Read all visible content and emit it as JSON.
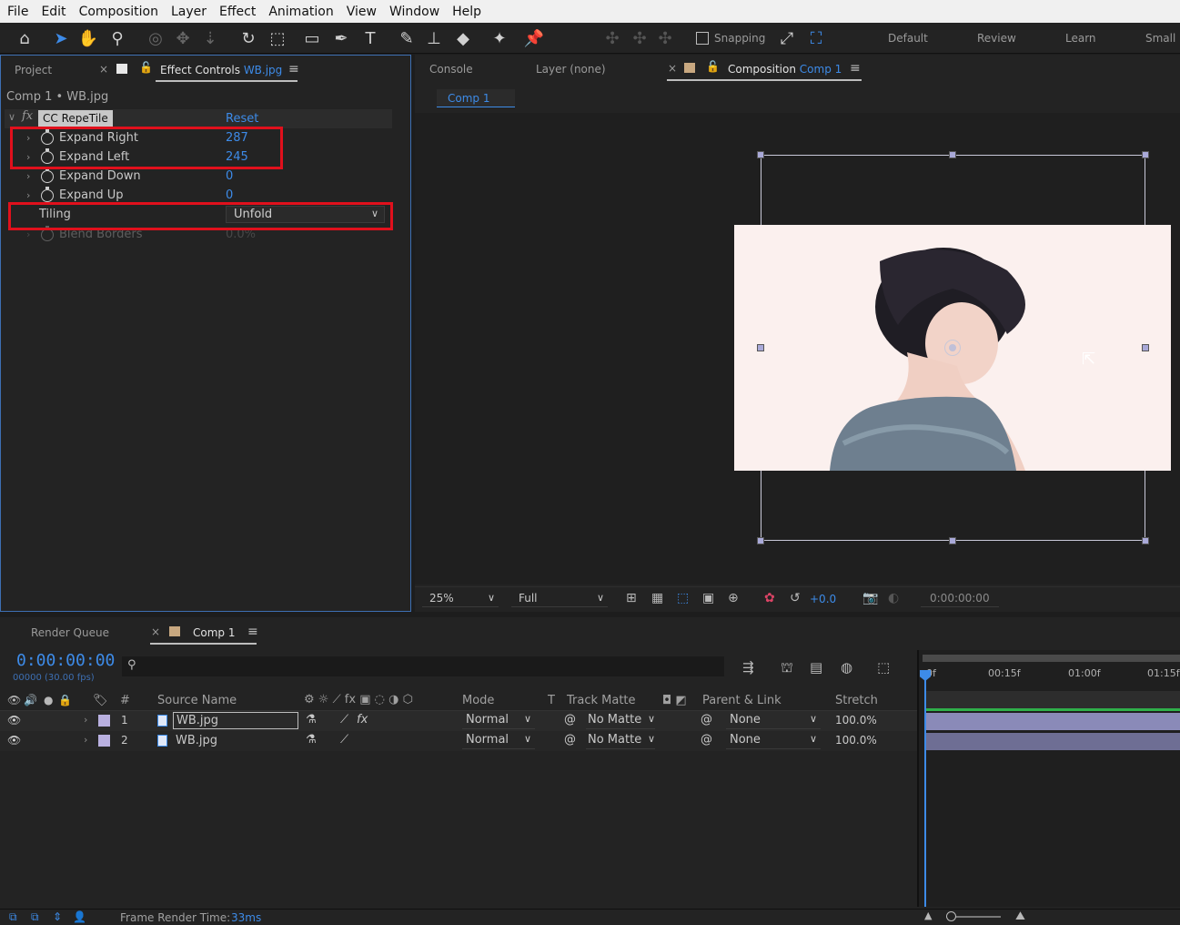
{
  "menu": [
    "File",
    "Edit",
    "Composition",
    "Layer",
    "Effect",
    "Animation",
    "View",
    "Window",
    "Help"
  ],
  "toolbar": {
    "snapping_label": "Snapping",
    "workspaces": [
      "Default",
      "Review",
      "Learn",
      "Small"
    ]
  },
  "left_panel": {
    "tab_project": "Project",
    "tab_effect_controls": "Effect Controls",
    "tab_effect_controls_target": "WB.jpg",
    "breadcrumb": "Comp 1 • WB.jpg",
    "effect_fx": "fx",
    "effect_name": "CC RepeTile",
    "reset_label": "Reset",
    "params": [
      {
        "name": "Expand Right",
        "value": "287"
      },
      {
        "name": "Expand Left",
        "value": "245"
      },
      {
        "name": "Expand Down",
        "value": "0"
      },
      {
        "name": "Expand Up",
        "value": "0"
      }
    ],
    "tiling_label": "Tiling",
    "tiling_value": "Unfold",
    "blend_label": "Blend Borders",
    "blend_value": "0.0%"
  },
  "viewer": {
    "tab_console": "Console",
    "tab_layer": "Layer (none)",
    "tab_composition": "Composition",
    "tab_composition_target": "Comp 1",
    "comp_subtab": "Comp 1",
    "zoom": "25%",
    "resolution": "Full",
    "exposure": "+0.0",
    "timecode": "0:00:00:00"
  },
  "timeline": {
    "tab_render_queue": "Render Queue",
    "tab_comp": "Comp 1",
    "current_time": "0:00:00:00",
    "frame_info": "00000 (30.00 fps)",
    "search_placeholder": "",
    "ruler": [
      "0f",
      "00:15f",
      "01:00f",
      "01:15f"
    ],
    "headers": {
      "num": "#",
      "source": "Source Name",
      "mode": "Mode",
      "t": "T",
      "track_matte": "Track Matte",
      "parent": "Parent & Link",
      "stretch": "Stretch"
    },
    "layers": [
      {
        "num": "1",
        "name": "WB.jpg",
        "mode": "Normal",
        "matte": "No Matte",
        "parent": "None",
        "stretch": "100.0%"
      },
      {
        "num": "2",
        "name": "WB.jpg",
        "mode": "Normal",
        "matte": "No Matte",
        "parent": "None",
        "stretch": "100.0%"
      }
    ],
    "frame_render_label": "Frame Render Time:",
    "frame_render_value": "33ms"
  },
  "colors": {
    "accent": "#3d8be8",
    "highlight_box": "#e0101c",
    "label_color": "#b9b0e0"
  }
}
